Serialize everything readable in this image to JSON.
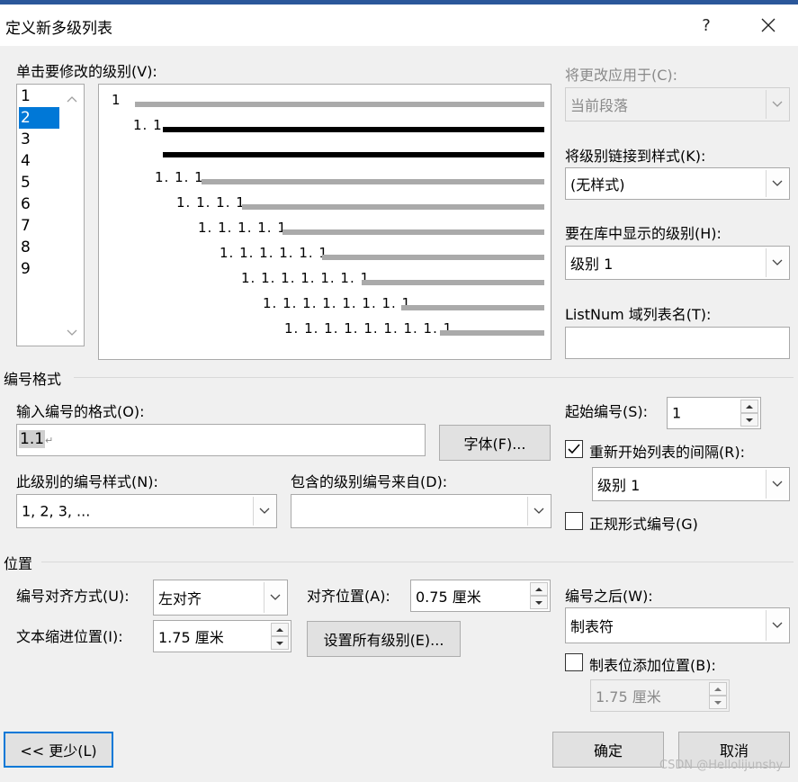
{
  "window": {
    "title": "定义新多级列表",
    "help": "?",
    "close": "×"
  },
  "levels": {
    "label": "单击要修改的级别(V):",
    "items": [
      "1",
      "2",
      "3",
      "4",
      "5",
      "6",
      "7",
      "8",
      "9"
    ],
    "selected": "2"
  },
  "preview": {
    "labels": [
      "1",
      "1. 1",
      "1. 1. 1",
      "1. 1. 1. 1",
      "1. 1. 1. 1. 1",
      "1. 1. 1. 1. 1. 1",
      "1. 1. 1. 1. 1. 1. 1",
      "1. 1. 1. 1. 1. 1. 1. 1",
      "1. 1. 1. 1. 1. 1. 1. 1. 1"
    ]
  },
  "right_panel": {
    "apply_label": "将更改应用于(C):",
    "apply_value": "当前段落",
    "link_label": "将级别链接到样式(K):",
    "link_value": "(无样式)",
    "gallery_label": "要在库中显示的级别(H):",
    "gallery_value": "级别 1",
    "listnum_label": "ListNum 域列表名(T):",
    "listnum_value": ""
  },
  "number_format": {
    "section": "编号格式",
    "format_label": "输入编号的格式(O):",
    "format_value": "1.1",
    "para_mark": "↵",
    "font_button": "字体(F)...",
    "style_label": "此级别的编号样式(N):",
    "style_value": "1, 2, 3, ...",
    "include_label": "包含的级别编号来自(D):",
    "include_value": "",
    "start_label": "起始编号(S):",
    "start_value": "1",
    "restart_label": "重新开始列表的间隔(R):",
    "restart_checked": true,
    "restart_value": "级别 1",
    "legal_label": "正规形式编号(G)",
    "legal_checked": false
  },
  "position": {
    "section": "位置",
    "align_label": "编号对齐方式(U):",
    "align_value": "左对齐",
    "aligned_at_label": "对齐位置(A):",
    "aligned_at_value": "0.75 厘米",
    "indent_label": "文本缩进位置(I):",
    "indent_value": "1.75 厘米",
    "set_all_button": "设置所有级别(E)...",
    "follow_label": "编号之后(W):",
    "follow_value": "制表符",
    "tab_stop_label": "制表位添加位置(B):",
    "tab_stop_checked": false,
    "tab_stop_value": "1.75 厘米"
  },
  "footer": {
    "less_button": "<< 更少(L)",
    "ok_button": "确定",
    "cancel_button": "取消",
    "watermark": "CSDN @Hellolijunshy"
  },
  "colors": {
    "accent": "#0078d7",
    "titlebar_strip": "#2b579a",
    "dialog_bg": "#f0f0f0"
  }
}
